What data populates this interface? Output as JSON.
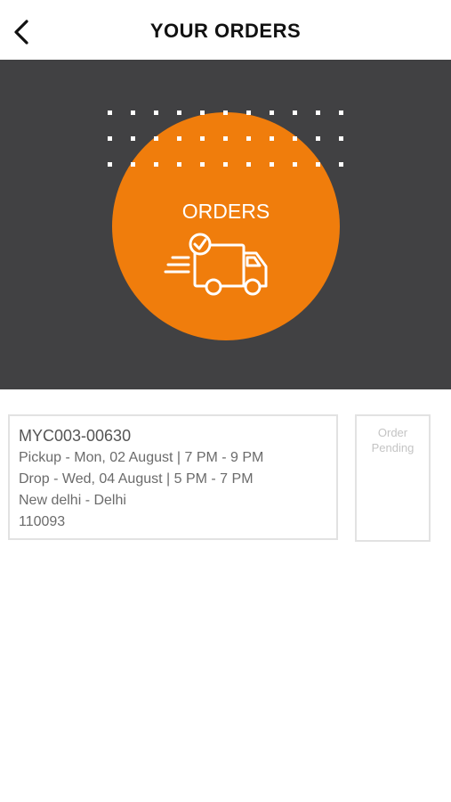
{
  "header": {
    "title": "YOUR ORDERS",
    "back_icon": "chevron-left-icon"
  },
  "hero": {
    "banner_label": "ORDERS",
    "circle_color": "#F07D0C",
    "background_color": "#414143",
    "truck_icon": "delivery-truck-check-icon"
  },
  "orders": [
    {
      "order_id": "MYC003-00630",
      "pickup": "Pickup - Mon, 02 August | 7 PM - 9 PM",
      "drop": "Drop - Wed, 04 August | 5 PM - 7 PM",
      "city": "New delhi - Delhi",
      "pincode": "110093",
      "status_line1": "Order",
      "status_line2": "Pending"
    }
  ]
}
